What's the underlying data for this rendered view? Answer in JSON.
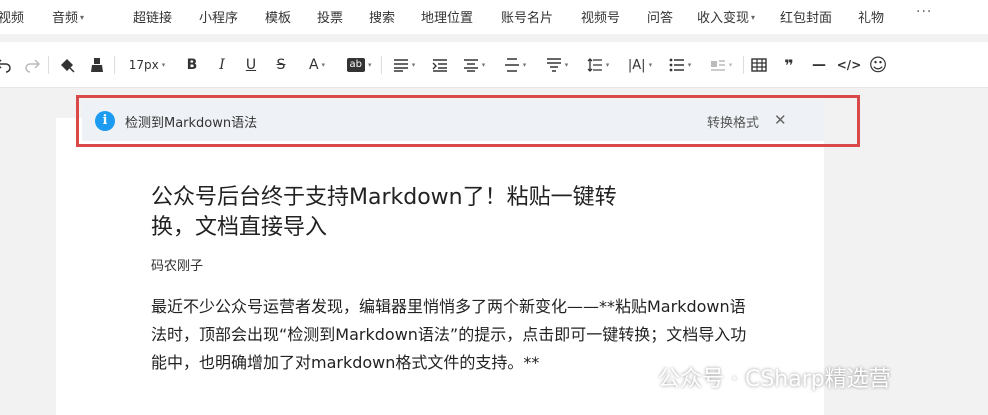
{
  "menubar": {
    "items": [
      {
        "label": "视频"
      },
      {
        "label": "音频",
        "dropdown": true
      },
      {
        "label": "超链接"
      },
      {
        "label": "小程序"
      },
      {
        "label": "模板"
      },
      {
        "label": "投票"
      },
      {
        "label": "搜索"
      },
      {
        "label": "地理位置"
      },
      {
        "label": "账号名片"
      },
      {
        "label": "视频号"
      },
      {
        "label": "问答"
      },
      {
        "label": "收入变现",
        "dropdown": true
      },
      {
        "label": "红包封面"
      },
      {
        "label": "礼物"
      }
    ],
    "more_label": "···"
  },
  "toolbar": {
    "font_size": "17px",
    "bold": "B",
    "italic": "I",
    "underline": "U",
    "strike": "S",
    "font_color": "A",
    "bg_color": "ab",
    "letter_spacing": "|A|",
    "quote": "❞",
    "hr": "—",
    "code": "</>",
    "emoji": "☺"
  },
  "notice": {
    "message": "检测到Markdown语法",
    "action": "转换格式",
    "close": "✕"
  },
  "article": {
    "title": "公众号后台终于支持Markdown了！粘贴一键转换，文档直接导入",
    "author": "码农刚子",
    "body": "最近不少公众号运营者发现，编辑器里悄悄多了两个新变化——**粘贴Markdown语法时，顶部会出现“检测到Markdown语法”的提示，点击即可一键转换；文档导入功能中，也明确增加了对markdown格式文件的支持。**"
  },
  "watermark": {
    "text": "公众号 · CSharp精选营"
  },
  "colors": {
    "highlight_border": "#d9494a",
    "info_icon": "#1d9bf0",
    "notice_bg": "#eef1f5"
  }
}
